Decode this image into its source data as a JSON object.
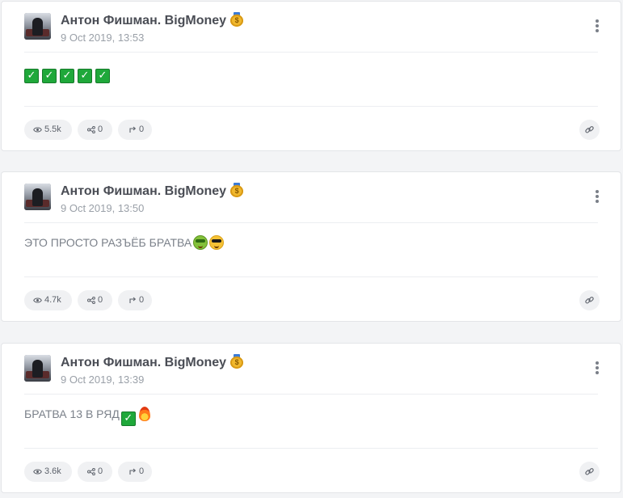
{
  "posts": [
    {
      "author": "Антон Фишман. BigMoney",
      "author_badge_icon": "money-bag-icon",
      "timestamp": "9 Oct 2019, 13:53",
      "text": "",
      "text_emojis": [
        "check-mark-button-icon",
        "check-mark-button-icon",
        "check-mark-button-icon",
        "check-mark-button-icon",
        "check-mark-button-icon"
      ],
      "views": "5.5k",
      "shares": "0",
      "reposts": "0"
    },
    {
      "author": "Антон Фишман. BigMoney",
      "author_badge_icon": "money-bag-icon",
      "timestamp": "9 Oct 2019, 13:50",
      "text": "ЭТО ПРОСТО РАЗЪЁБ БРАТВА",
      "text_emojis": [
        "money-mouth-face-icon",
        "smiling-face-sunglasses-icon"
      ],
      "views": "4.7k",
      "shares": "0",
      "reposts": "0"
    },
    {
      "author": "Антон Фишман. BigMoney",
      "author_badge_icon": "money-bag-icon",
      "timestamp": "9 Oct 2019, 13:39",
      "text": "БРАТВА 13 В РЯД",
      "text_emojis": [
        "check-mark-button-icon",
        "fire-icon"
      ],
      "views": "3.6k",
      "shares": "0",
      "reposts": "0"
    }
  ],
  "colors": {
    "page_bg": "#f3f4f6",
    "card_bg": "#ffffff",
    "author_text": "#4a4d55",
    "muted_text": "#9aa0a8",
    "pill_bg": "#f0f1f3"
  }
}
